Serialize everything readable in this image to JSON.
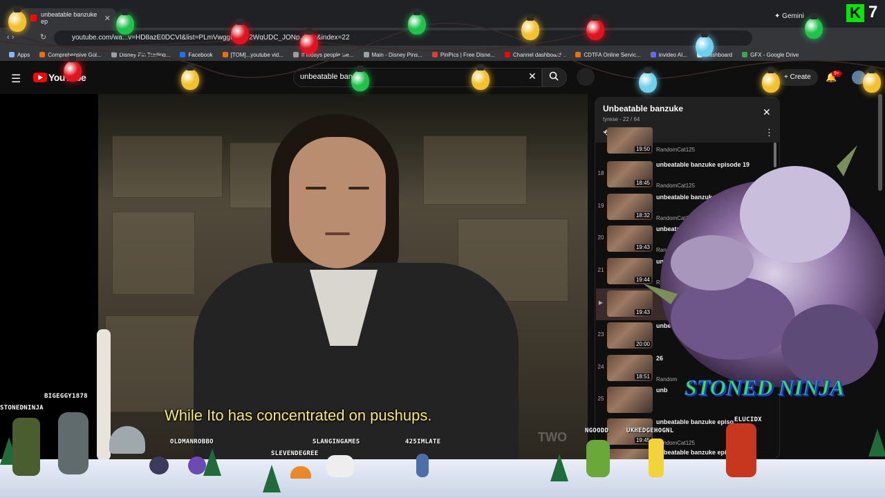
{
  "browser": {
    "tab_title": "unbeatable banzuke ep",
    "url": "youtube.com/wa...v=HD8azE0DCVI&list=PLmVwggD...vY2WqUDC_JONp...QJr&index=22",
    "gemini_label": "Gemini",
    "kick_number": "7",
    "kick_letter": "K",
    "bookmarks": [
      {
        "label": "Apps",
        "color": "#8ab4f8"
      },
      {
        "label": "Comprehensive Gol...",
        "color": "#e8710a"
      },
      {
        "label": "Disney Pin Trading...",
        "color": "#9aa0a6"
      },
      {
        "label": "Facebook",
        "color": "#1877f2"
      },
      {
        "label": "[TOM]...youtube vid...",
        "color": "#e8710a"
      },
      {
        "label": "If todays people we...",
        "color": "#9aa0a6"
      },
      {
        "label": "Main - Disney Pins...",
        "color": "#9aa0a6"
      },
      {
        "label": "PinPics | Free Disne...",
        "color": "#e53935"
      },
      {
        "label": "Channel dashboard...",
        "color": "#ff0000"
      },
      {
        "label": "CDTFA Online Servic...",
        "color": "#e8710a"
      },
      {
        "label": "invideo AI...",
        "color": "#5f6bff"
      },
      {
        "label": "Dashboard",
        "color": "#e8eaed"
      },
      {
        "label": "GFX - Google Drive",
        "color": "#34a853"
      }
    ]
  },
  "youtube": {
    "logo_text": "YouTube",
    "search_value": "unbeatable ban",
    "create_label": "Create",
    "notif_badge": "9+"
  },
  "video": {
    "subtitle": "While Ito has concentrated on pushups.",
    "watermark": "TWO"
  },
  "playlist": {
    "title": "Unbeatable banzuke",
    "subtitle": "tyrese - 22 / 64",
    "items": [
      {
        "index": "",
        "title": "",
        "channel": "RandomCat125",
        "duration": "19:50"
      },
      {
        "index": "18",
        "title": "unbeatable banzuke episode 19",
        "channel": "RandomCat125",
        "duration": "18:45"
      },
      {
        "index": "19",
        "title": "unbeatable banzuke episode 20",
        "channel": "RandomCat125",
        "duration": "18:32"
      },
      {
        "index": "20",
        "title": "unbeatable banzuke episode 21",
        "channel": "RandomCat125",
        "duration": "19:43"
      },
      {
        "index": "21",
        "title": "unbeatab 23",
        "channel": "RandomCat",
        "duration": "19:44"
      },
      {
        "index": "▶",
        "title": "",
        "channel": "",
        "duration": "19:43"
      },
      {
        "index": "23",
        "title": "unbeat 25",
        "channel": "",
        "duration": "20:00"
      },
      {
        "index": "24",
        "title": "26",
        "channel": "Random",
        "duration": "18:51"
      },
      {
        "index": "25",
        "title": "unb",
        "channel": "",
        "duration": ""
      },
      {
        "index": "",
        "title": "unbeatable banzuke episo",
        "channel": "RandomCat125",
        "duration": "19:45"
      },
      {
        "index": "",
        "title": "unbeatable banzuke episo",
        "channel": "",
        "duration": ""
      }
    ]
  },
  "overlay": {
    "brand_text": "STONED NINJA",
    "viewers": [
      "BIGEGGY1878",
      "STONEDNINJA",
      "OLDMANROBBO",
      "SLANGINGAMES",
      "SLEVENDEGREE",
      "425IMLATE",
      "NGOODD",
      "UKHEDGEHOGNL",
      "ELUCIDX"
    ]
  },
  "colors": {
    "accent": "#ff0000",
    "subtitle": "#f3ee62",
    "brand_green": "#3be052"
  }
}
